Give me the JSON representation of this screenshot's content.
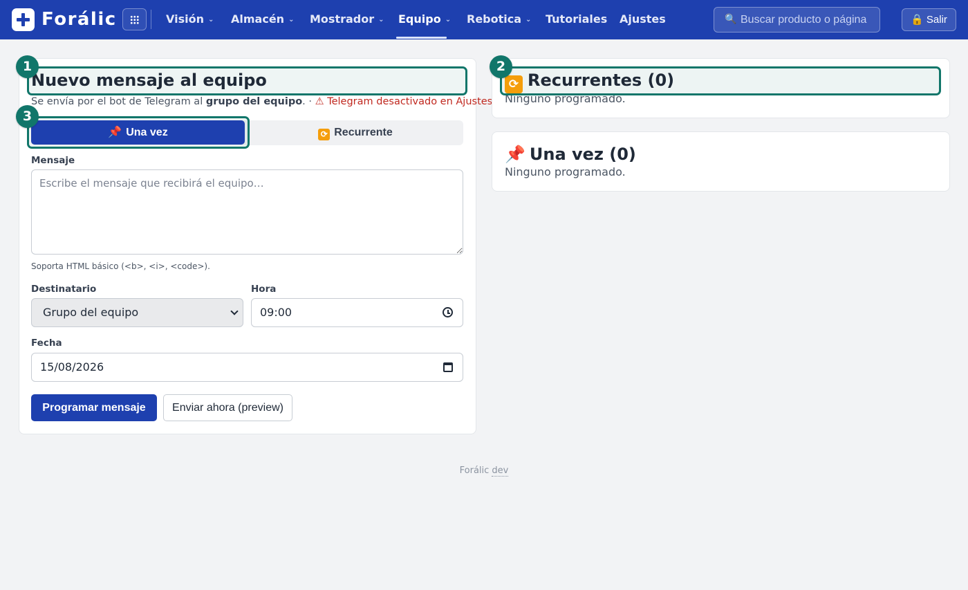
{
  "app": {
    "brand": "Forálic"
  },
  "nav": {
    "items": [
      {
        "label": "Visión",
        "chevron": "⌄"
      },
      {
        "label": "Almacén",
        "chevron": "⌄"
      },
      {
        "label": "Mostrador",
        "chevron": "⌄"
      },
      {
        "label": "Equipo",
        "chevron": "⌄",
        "active": true
      },
      {
        "label": "Rebotica",
        "chevron": "⌄"
      },
      {
        "label": "Tutoriales"
      },
      {
        "label": "Ajustes"
      }
    ],
    "search_placeholder": "Buscar producto o página",
    "search_icon": "🔍",
    "logout_label": "🔒 Salir"
  },
  "form": {
    "title": "Nuevo mensaje al equipo",
    "subtitle_prefix": "Se envía por el bot de Telegram al ",
    "subtitle_bold": "grupo del equipo",
    "subtitle_sep": ". · ",
    "subtitle_warning": "⚠ Telegram desactivado en Ajustes",
    "mode_once": "Una vez",
    "mode_recurring": "Recurrente",
    "message_label": "Mensaje",
    "message_placeholder": "Escribe el mensaje que recibirá el equipo…",
    "message_hint": "Soporta HTML básico (<b>, <i>, <code>).",
    "recipient_label": "Destinatario",
    "recipient_value": "Grupo del equipo",
    "time_label": "Hora",
    "time_value": "09:00",
    "date_label": "Fecha",
    "date_value": "15/08/2026",
    "schedule_button": "Programar mensaje",
    "send_now_button": "Enviar ahora (preview)"
  },
  "recurring": {
    "title": "Recurrentes (0)",
    "empty": "Ninguno programado."
  },
  "once": {
    "title": "Una vez (0)",
    "empty": "Ninguno programado."
  },
  "callouts": [
    "1",
    "2",
    "3"
  ],
  "footer": {
    "brand": "Forálic",
    "env": "dev"
  },
  "colors": {
    "primary": "#1e40af",
    "highlight": "#11766a",
    "warning": "#c0281f"
  }
}
